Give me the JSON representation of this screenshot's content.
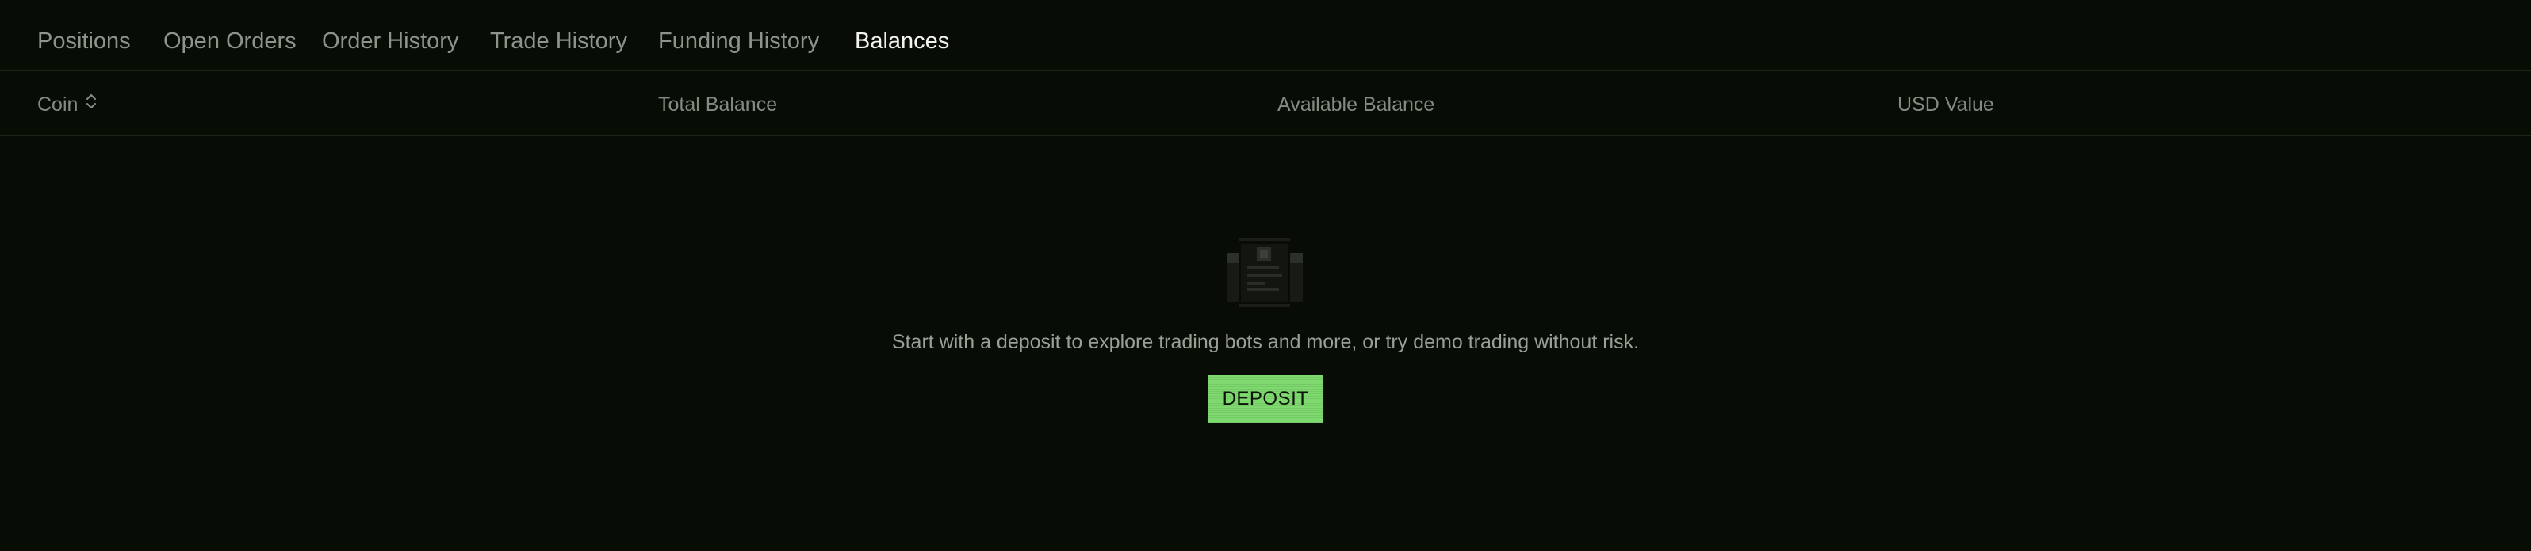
{
  "tabs": [
    {
      "label": "Positions"
    },
    {
      "label": "Open Orders"
    },
    {
      "label": "Order History"
    },
    {
      "label": "Trade History"
    },
    {
      "label": "Funding History"
    },
    {
      "label": "Balances"
    }
  ],
  "active_tab": "Balances",
  "table": {
    "columns": [
      {
        "label": "Coin",
        "sortable": true
      },
      {
        "label": "Total Balance"
      },
      {
        "label": "Available Balance"
      },
      {
        "label": "USD Value"
      }
    ],
    "rows": []
  },
  "empty_state": {
    "icon": "document-icon",
    "message": "Start with a deposit to explore trading bots and more, or try demo trading without risk.",
    "button_label": "DEPOSIT"
  },
  "colors": {
    "background": "#070d04",
    "accent": "#7ed96f",
    "active_text": "#f2f4ef",
    "muted_text": "#8e938b"
  }
}
